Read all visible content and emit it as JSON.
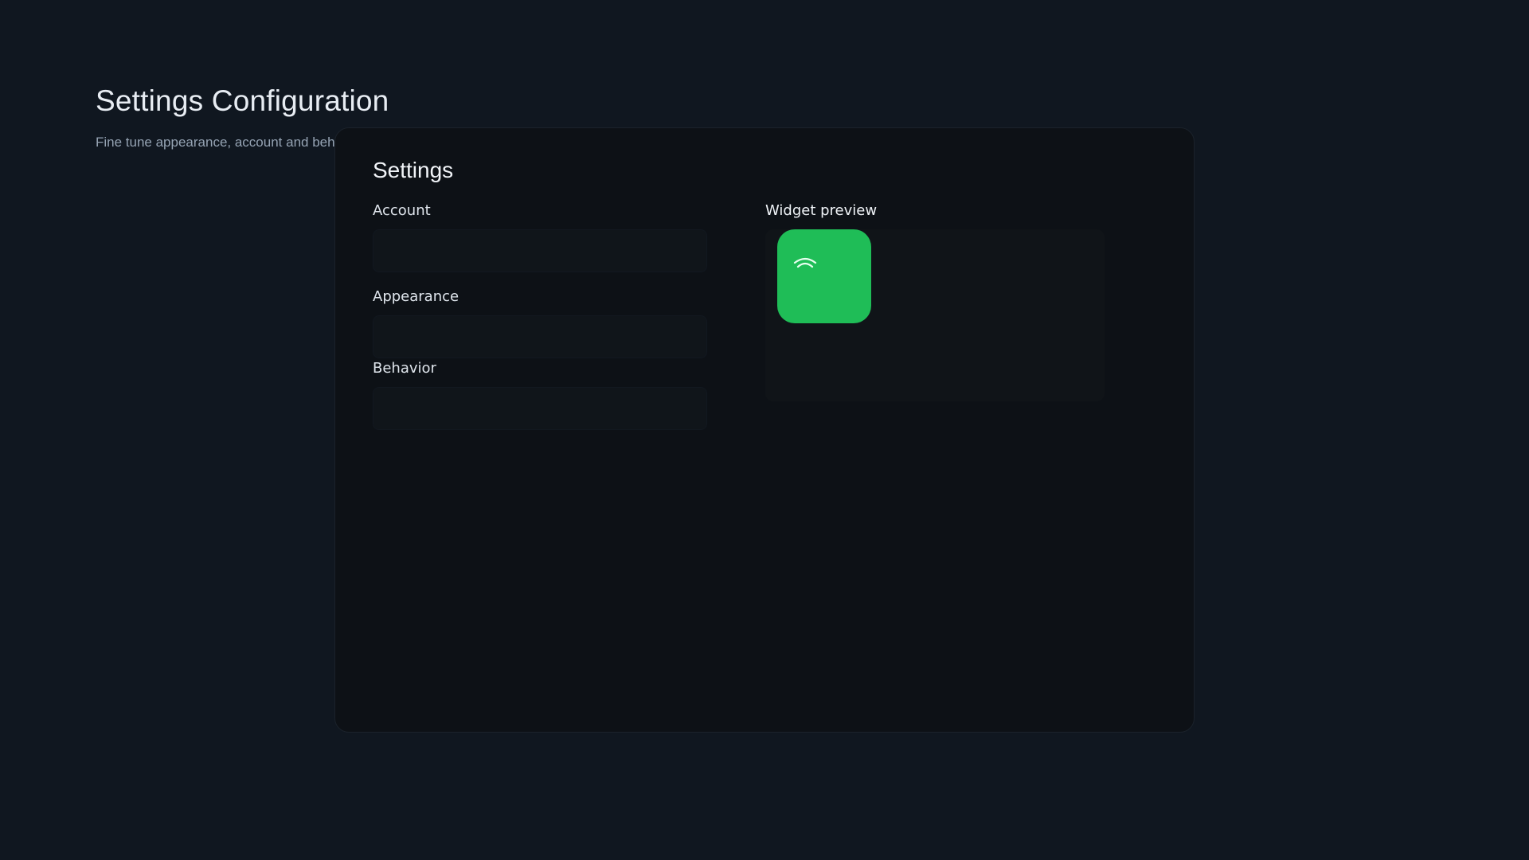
{
  "header": {
    "title": "Settings Configuration",
    "subtitle": "Fine tune appearance, account and behavior"
  },
  "card": {
    "title": "Settings",
    "sections": [
      {
        "label": "Account"
      },
      {
        "label": "Appearance"
      },
      {
        "label": "Behavior"
      }
    ]
  },
  "preview": {
    "label": "Widget preview",
    "widget_color": "#1fbd57",
    "widget_icon": "wifi-icon"
  },
  "colors": {
    "background": "#101720",
    "card": "#0d1116",
    "accent": "#1fbd57"
  }
}
